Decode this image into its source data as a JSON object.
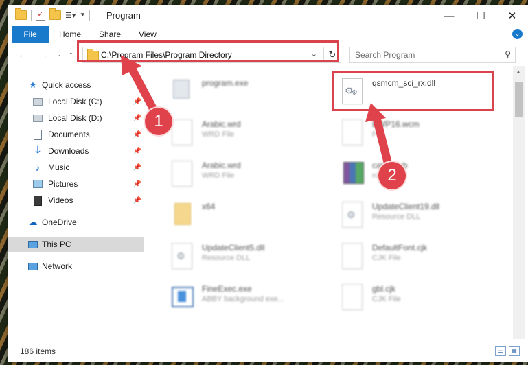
{
  "window": {
    "title": "Program"
  },
  "ribbon": {
    "file": "File",
    "home": "Home",
    "share": "Share",
    "view": "View"
  },
  "address": {
    "path": "C:\\Program Files\\Program Directory"
  },
  "search": {
    "placeholder": "Search Program"
  },
  "sidebar": {
    "items": [
      {
        "label": "Quick access",
        "icon": "star-icon"
      },
      {
        "label": "Local Disk (C:)",
        "icon": "drive-icon"
      },
      {
        "label": "Local Disk (D:)",
        "icon": "drive-icon"
      },
      {
        "label": "Documents",
        "icon": "documents-icon"
      },
      {
        "label": "Downloads",
        "icon": "download-icon"
      },
      {
        "label": "Music",
        "icon": "music-icon"
      },
      {
        "label": "Pictures",
        "icon": "pictures-icon"
      },
      {
        "label": "Videos",
        "icon": "videos-icon"
      },
      {
        "label": "OneDrive",
        "icon": "cloud-icon"
      },
      {
        "label": "This PC",
        "icon": "computer-icon"
      },
      {
        "label": "Network",
        "icon": "network-icon"
      }
    ]
  },
  "files": [
    {
      "name": "program.exe",
      "type": ""
    },
    {
      "name": "qsmcm_sci_rx.dll",
      "type": ""
    },
    {
      "name": "Arabic.wrd",
      "type": "WRD File"
    },
    {
      "name": "BWP16.wcm",
      "type": "File"
    },
    {
      "name": "Arabic.wrd",
      "type": "WRD File"
    },
    {
      "name": "cates.cab",
      "type": "rchive"
    },
    {
      "name": "x64",
      "type": ""
    },
    {
      "name": "UpdateClient19.dll",
      "type": "Resource DLL"
    },
    {
      "name": "UpdateClient5.dll",
      "type": "Resource DLL"
    },
    {
      "name": "DefaultFont.cjk",
      "type": "CJK File"
    },
    {
      "name": "FineExec.exe",
      "type": "ABBY background exe..."
    },
    {
      "name": "gbl.cjk",
      "type": "CJK File"
    }
  ],
  "status": {
    "count": "186 items"
  },
  "callouts": {
    "one": "1",
    "two": "2"
  },
  "colors": {
    "accent": "#1979ca",
    "highlight": "#d9434d"
  }
}
